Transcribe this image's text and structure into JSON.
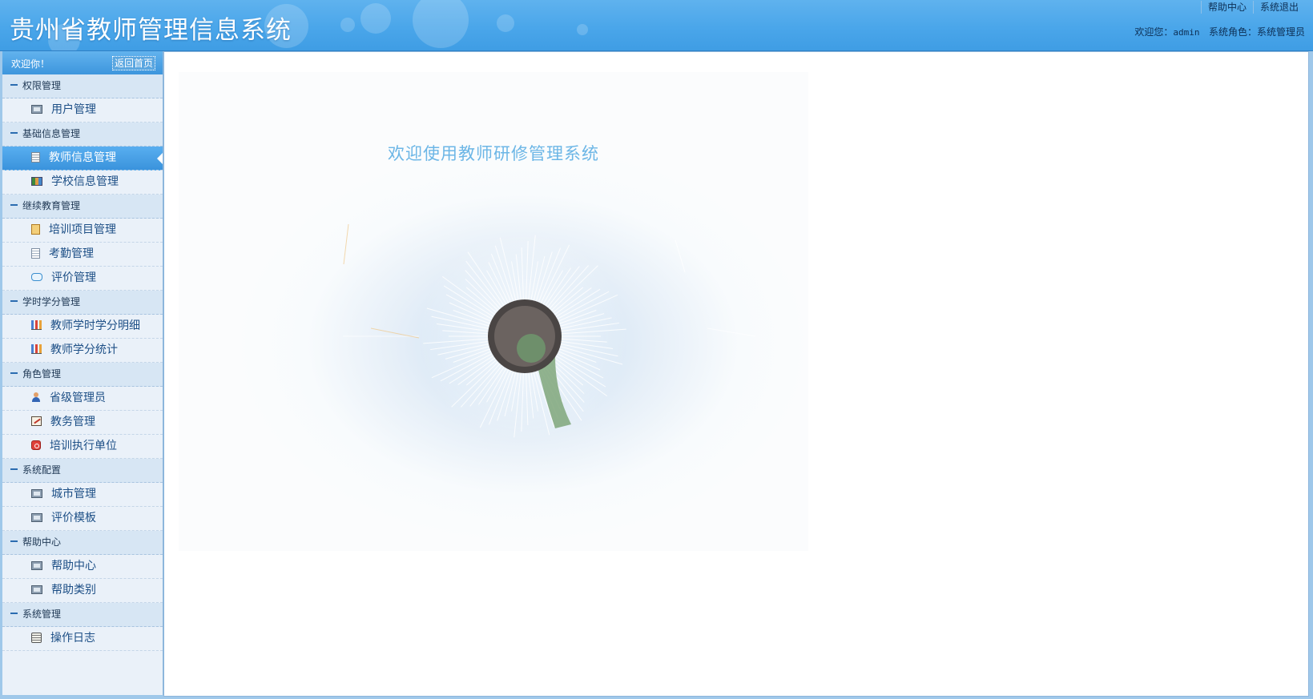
{
  "header": {
    "title": "贵州省教师管理信息系统",
    "links": [
      "帮助中心",
      "系统退出"
    ],
    "user_prefix": "欢迎您：",
    "username": "admin",
    "role_prefix": "系统角色：",
    "role": "系统管理员"
  },
  "sidebar": {
    "welcome": "欢迎你！",
    "home_button": "返回首页",
    "groups": [
      {
        "label": "权限管理",
        "items": [
          {
            "label": "用户管理",
            "icon": "image-icon"
          }
        ]
      },
      {
        "label": "基础信息管理",
        "items": [
          {
            "label": "教师信息管理",
            "icon": "document-icon",
            "active": true
          },
          {
            "label": "学校信息管理",
            "icon": "grid-icon"
          }
        ]
      },
      {
        "label": "继续教育管理",
        "items": [
          {
            "label": "培训项目管理",
            "icon": "notebook-icon"
          },
          {
            "label": "考勤管理",
            "icon": "checklist-icon"
          },
          {
            "label": "评价管理",
            "icon": "chat-icon"
          }
        ]
      },
      {
        "label": "学时学分管理",
        "items": [
          {
            "label": "教师学时学分明细",
            "icon": "bar-chart-icon"
          },
          {
            "label": "教师学分统计",
            "icon": "bar-chart-icon"
          }
        ]
      },
      {
        "label": "角色管理",
        "items": [
          {
            "label": "省级管理员",
            "icon": "user-icon"
          },
          {
            "label": "教务管理",
            "icon": "edit-icon"
          },
          {
            "label": "培训执行单位",
            "icon": "unit-icon"
          }
        ]
      },
      {
        "label": "系统配置",
        "items": [
          {
            "label": "城市管理",
            "icon": "image-icon"
          },
          {
            "label": "评价模板",
            "icon": "image-icon"
          }
        ]
      },
      {
        "label": "帮助中心",
        "items": [
          {
            "label": "帮助中心",
            "icon": "image-icon"
          },
          {
            "label": "帮助类别",
            "icon": "image-icon"
          }
        ]
      },
      {
        "label": "系统管理",
        "items": [
          {
            "label": "操作日志",
            "icon": "log-icon"
          }
        ]
      }
    ]
  },
  "main": {
    "welcome_text": "欢迎使用教师研修管理系统"
  },
  "colors": {
    "header_blue": "#4aa6ea",
    "active_item": "#3a93dc",
    "welcome_text": "#6cb6e6"
  }
}
